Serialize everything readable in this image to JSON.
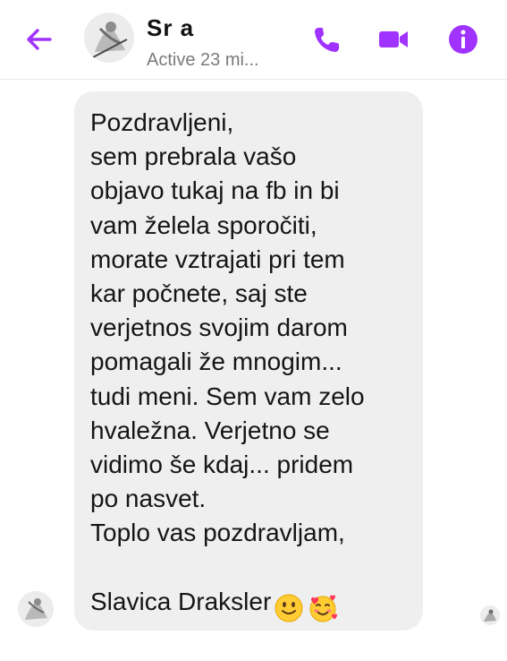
{
  "header": {
    "contact_name": "Sr      a",
    "status": "Active 23 mi...",
    "icons": [
      "back-arrow-icon",
      "phone-icon",
      "video-camera-icon",
      "info-icon"
    ],
    "accent_color": "#a033ff"
  },
  "message": {
    "text": "Pozdravljeni,\nsem prebrala vašo\nobjavo tukaj na fb in bi\nvam želela sporočiti,\nmorate vztrajati pri tem\nkar počnete, saj ste\nverjetnos svojim darom\npomagali že mnogim...\ntudi meni. Sem vam zelo\nhvaležna. Verjetno se\nvidimo še kdaj... pridem\npo nasvet.\nToplo vas pozdravljam,\n\nSlavica Draksler",
    "emojis": [
      "slightly-smiling-face-emoji",
      "smiling-face-with-hearts-emoji"
    ],
    "bubble_color": "#efefef"
  }
}
